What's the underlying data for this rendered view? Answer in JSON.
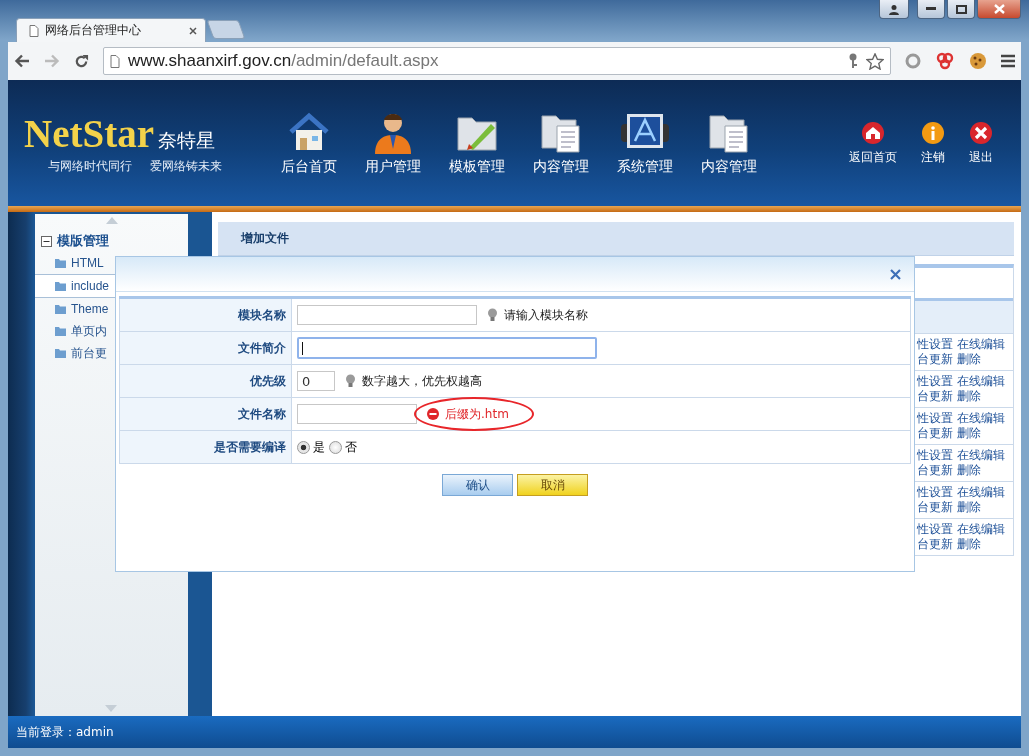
{
  "browser": {
    "tabs": [
      {
        "kind": "page",
        "title": "网络后台管理中心",
        "selected": true
      },
      {
        "kind": "new",
        "selected": false
      }
    ],
    "url_host": "www.shaanxirf.gov.cn",
    "url_path": "/admin/default.aspx"
  },
  "header": {
    "logo": "NetStar",
    "logo_cn": "奈特星",
    "slogans": [
      "与网络时代同行",
      "爱网络铸未来"
    ],
    "nav": [
      {
        "label": "后台首页"
      },
      {
        "label": "用户管理"
      },
      {
        "label": "模板管理"
      },
      {
        "label": "内容管理"
      },
      {
        "label": "系统管理"
      },
      {
        "label": "内容管理"
      }
    ],
    "actions": [
      {
        "label": "返回首页"
      },
      {
        "label": "注销"
      },
      {
        "label": "退出"
      }
    ]
  },
  "sidebar": {
    "group": {
      "label": "模版管理",
      "expanded": true
    },
    "items": [
      {
        "label": "HTML",
        "selected": false
      },
      {
        "label": "include",
        "selected": true
      },
      {
        "label": "Theme",
        "selected": false
      },
      {
        "label": "单页内",
        "selected": false
      },
      {
        "label": "前台更",
        "selected": false
      }
    ]
  },
  "panel": {
    "title": "增加文件",
    "rows": [
      {
        "links": [
          "性设置",
          "在线编辑",
          "台更新",
          "删除"
        ]
      },
      {
        "links": [
          "性设置",
          "在线编辑",
          "台更新",
          "删除"
        ]
      },
      {
        "links": [
          "性设置",
          "在线编辑",
          "台更新",
          "删除"
        ]
      },
      {
        "links": [
          "性设置",
          "在线编辑",
          "台更新",
          "删除"
        ]
      },
      {
        "links": [
          "性设置",
          "在线编辑",
          "台更新",
          "删除"
        ]
      },
      {
        "links": [
          "性设置",
          "在线编辑",
          "台更新",
          "删除"
        ]
      }
    ]
  },
  "dialog": {
    "fields": [
      {
        "kind": "text",
        "label": "模块名称",
        "focused": false,
        "hint": {
          "kind": "tip",
          "text": "请输入模块名称",
          "circled": false
        }
      },
      {
        "kind": "wide",
        "label": "文件简介",
        "focused": true
      },
      {
        "kind": "number",
        "label": "优先级",
        "value": "0",
        "focused": false,
        "hint": {
          "kind": "tip",
          "text": "数字越大，优先权越高",
          "circled": false
        }
      },
      {
        "kind": "short",
        "label": "文件名称",
        "focused": false,
        "hint": {
          "kind": "error",
          "text": "后缀为.htm",
          "circled": true
        }
      },
      {
        "kind": "radio",
        "label": "是否需要编译",
        "options": [
          {
            "label": "是",
            "selected": true
          },
          {
            "label": "否",
            "selected": false
          }
        ]
      }
    ],
    "buttons": [
      {
        "label": "确认",
        "kind": "primary"
      },
      {
        "label": "取消",
        "kind": "cancel"
      }
    ]
  },
  "status_bar": "当前登录：admin"
}
